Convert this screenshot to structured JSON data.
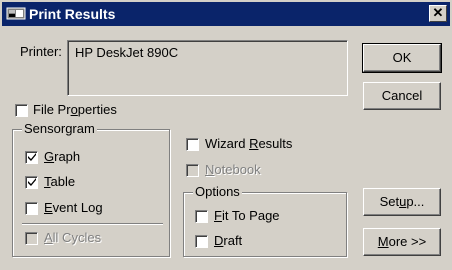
{
  "window": {
    "title": "Print Results",
    "close_glyph": "✕"
  },
  "printer": {
    "label": "Printer:",
    "value": "HP DeskJet 890C"
  },
  "buttons": {
    "ok": "OK",
    "cancel": "Cancel",
    "setup_pre": "Set",
    "setup_u": "u",
    "setup_post": "p...",
    "more_u": "M",
    "more_post": "ore >>"
  },
  "file_properties": {
    "pre": "File Pr",
    "u": "o",
    "post": "perties",
    "checked": false
  },
  "sensorgram": {
    "title": "Sensorgram",
    "graph": {
      "pre": "",
      "u": "G",
      "post": "raph",
      "checked": true
    },
    "table": {
      "pre": "",
      "u": "T",
      "post": "able",
      "checked": true
    },
    "event_log": {
      "pre": "",
      "u": "E",
      "post": "vent Log",
      "checked": false
    },
    "all_cycles": {
      "pre": "",
      "u": "A",
      "post": "ll Cycles",
      "checked": false,
      "disabled": true
    }
  },
  "wizard_results": {
    "pre": "Wizard ",
    "u": "R",
    "post": "esults",
    "checked": false
  },
  "notebook": {
    "pre": "",
    "u": "N",
    "post": "otebook",
    "checked": false,
    "disabled": true
  },
  "options": {
    "title": "Options",
    "fit_to_page": {
      "pre": "",
      "u": "F",
      "post": "it To Page",
      "checked": false
    },
    "draft": {
      "pre": "",
      "u": "D",
      "post": "raft",
      "checked": false
    }
  },
  "icons": {
    "title": "printer-app-icon",
    "close": "close-icon",
    "check": "checkmark-icon"
  }
}
